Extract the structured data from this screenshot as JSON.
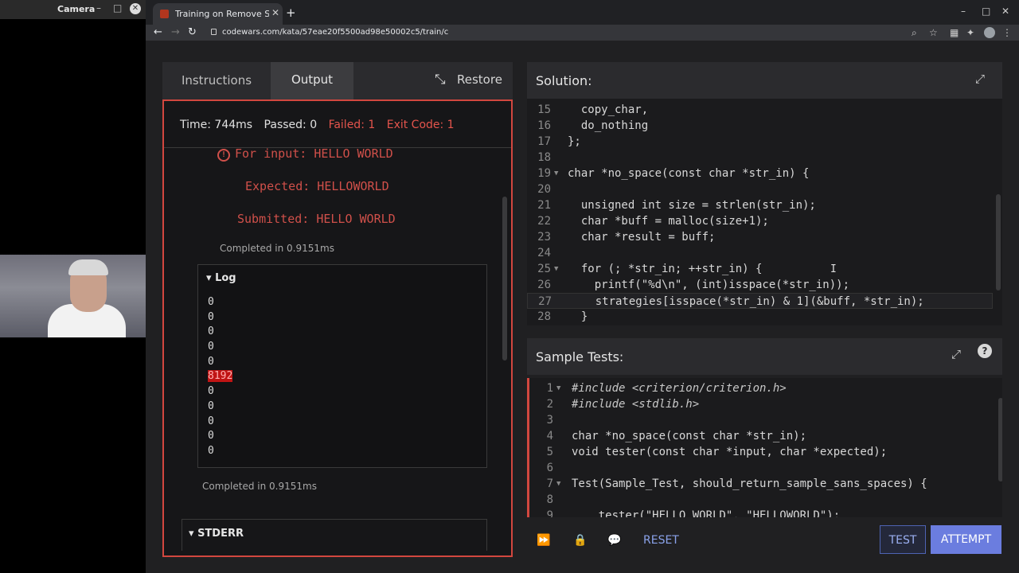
{
  "camera": {
    "title": "Camera",
    "minimize": "–",
    "maximize": "□",
    "close": "✕"
  },
  "browser": {
    "tab_title": "Training on Remove String Spaces",
    "tab_close": "✕",
    "new_tab": "+",
    "url": "codewars.com/kata/57eae20f5500ad98e50002c5/train/c",
    "window_controls": {
      "minimize": "–",
      "maximize": "□",
      "close": "✕"
    },
    "nav": {
      "back": "←",
      "forward": "→",
      "reload": "↻"
    }
  },
  "left_panel": {
    "tabs": {
      "instructions": "Instructions",
      "output": "Output"
    },
    "restore_label": "Restore",
    "status": {
      "time": "Time: 744ms",
      "passed": "Passed: 0",
      "failed": "Failed: 1",
      "exit": "Exit Code: 1"
    },
    "error": {
      "for_input": "For input: HELLO WORLD",
      "expected": "Expected: HELLOWORLD",
      "submitted": "Submitted: HELLO WORLD"
    },
    "completed_1": "Completed in 0.9151ms",
    "log": {
      "title": "Log",
      "values": [
        "0",
        "0",
        "0",
        "0",
        "0",
        "8192",
        "0",
        "0",
        "0",
        "0",
        "0"
      ],
      "highlight_value": "8192"
    },
    "completed_2": "Completed in 0.9151ms",
    "stderr_label": "STDERR"
  },
  "solution": {
    "title": "Solution:",
    "lines": [
      {
        "n": "15",
        "text": "  copy_char,"
      },
      {
        "n": "16",
        "text": "  do_nothing"
      },
      {
        "n": "17",
        "text": "};"
      },
      {
        "n": "18",
        "text": ""
      },
      {
        "n": "19",
        "text": "char *no_space(const char *str_in) {",
        "fold": true
      },
      {
        "n": "20",
        "text": ""
      },
      {
        "n": "21",
        "text": "  unsigned int size = strlen(str_in);"
      },
      {
        "n": "22",
        "text": "  char *buff = malloc(size+1);"
      },
      {
        "n": "23",
        "text": "  char *result = buff;"
      },
      {
        "n": "24",
        "text": ""
      },
      {
        "n": "25",
        "text": "  for (; *str_in; ++str_in) {",
        "fold": true
      },
      {
        "n": "26",
        "text": "    printf(\"%d\\n\", (int)isspace(*str_in));"
      },
      {
        "n": "27",
        "text": "    strategies[isspace(*str_in) & 1](&buff, *str_in);"
      },
      {
        "n": "28",
        "text": "  }"
      }
    ],
    "cursor": "I"
  },
  "sample_tests": {
    "title": "Sample Tests:",
    "help": "?",
    "lines": [
      {
        "n": "1",
        "text": "#include <criterion/criterion.h>",
        "fold": true
      },
      {
        "n": "2",
        "text": "#include <stdlib.h>"
      },
      {
        "n": "3",
        "text": ""
      },
      {
        "n": "4",
        "text": "char *no_space(const char *str_in);"
      },
      {
        "n": "5",
        "text": "void tester(const char *input, char *expected);"
      },
      {
        "n": "6",
        "text": ""
      },
      {
        "n": "7",
        "text": "Test(Sample_Test, should_return_sample_sans_spaces) {",
        "fold": true
      },
      {
        "n": "8",
        "text": ""
      },
      {
        "n": "9",
        "text": "    tester(\"HELLO WORLD\", \"HELLOWORLD\");"
      }
    ]
  },
  "bottom_bar": {
    "reset": "RESET",
    "test": "TEST",
    "attempt": "ATTEMPT"
  },
  "colors": {
    "accent": "#6b7ddf",
    "error": "#d2473f",
    "keyword": "#d86b84"
  }
}
